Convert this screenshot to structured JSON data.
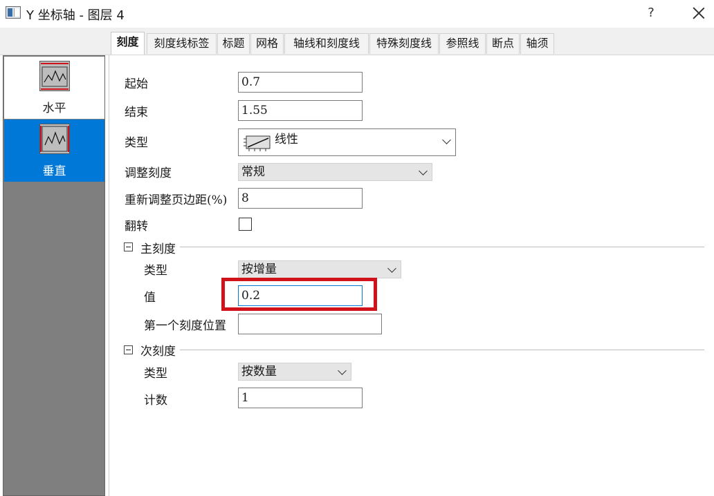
{
  "window": {
    "title": "Y 坐标轴 - 图层 4",
    "help_label": "?"
  },
  "tabs": [
    {
      "label": "刻度",
      "active": true
    },
    {
      "label": "刻度线标签"
    },
    {
      "label": "标题"
    },
    {
      "label": "网格"
    },
    {
      "label": "轴线和刻度线"
    },
    {
      "label": "特殊刻度线"
    },
    {
      "label": "参照线"
    },
    {
      "label": "断点"
    },
    {
      "label": "轴须"
    }
  ],
  "sidebar": {
    "items": [
      {
        "label": "水平",
        "icon": "horizontal-axis-icon",
        "selected": false
      },
      {
        "label": "垂直",
        "icon": "vertical-axis-icon",
        "selected": true
      }
    ]
  },
  "form": {
    "from": {
      "label": "起始",
      "value": "0.7"
    },
    "to": {
      "label": "结束",
      "value": "1.55"
    },
    "type": {
      "label": "类型",
      "value": "线性",
      "icon": "linear-scale-icon"
    },
    "rescale": {
      "label": "调整刻度",
      "value": "常规"
    },
    "rescale_margin": {
      "label": "重新调整页边距(%)",
      "value": "8"
    },
    "reverse": {
      "label": "翻转",
      "checked": false
    }
  },
  "major_ticks": {
    "header": "主刻度",
    "type": {
      "label": "类型",
      "value": "按增量"
    },
    "value": {
      "label": "值",
      "value": "0.2"
    },
    "first_tick": {
      "label": "第一个刻度位置",
      "value": ""
    }
  },
  "minor_ticks": {
    "header": "次刻度",
    "type": {
      "label": "类型",
      "value": "按数量"
    },
    "count": {
      "label": "计数",
      "value": "1"
    }
  },
  "colors": {
    "selection": "#0078d7",
    "highlight_box": "#d0131b",
    "sidebar_bg": "#7f7f7f"
  }
}
